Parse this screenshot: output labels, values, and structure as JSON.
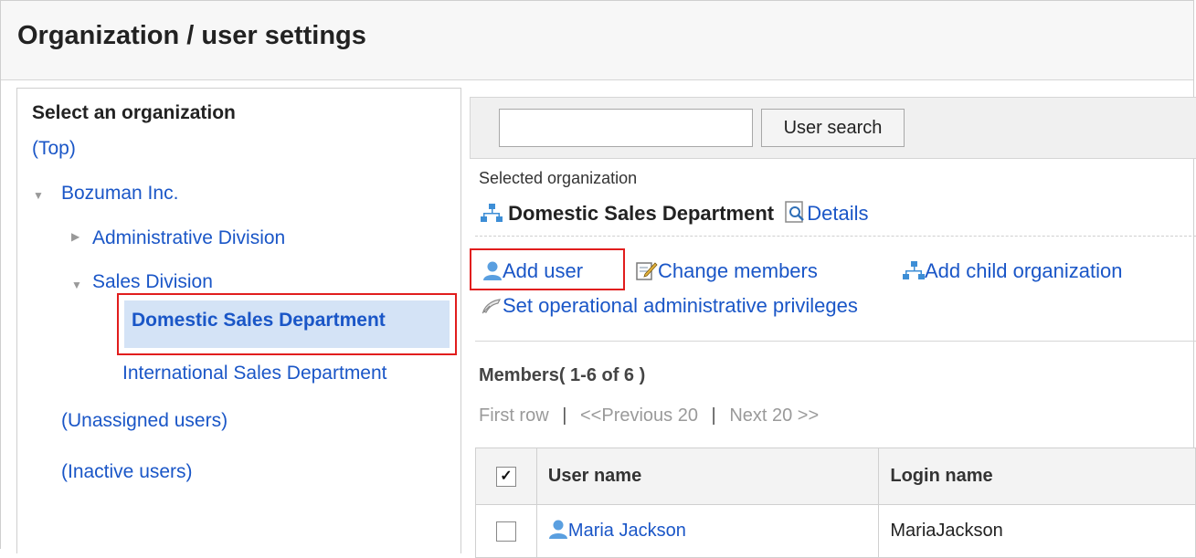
{
  "page": {
    "title": "Organization / user settings"
  },
  "left": {
    "heading": "Select an organization",
    "top_link": "(Top)",
    "tree": {
      "root": "Bozuman Inc.",
      "admin_division": "Administrative Division",
      "sales_division": "Sales Division",
      "domestic": "Domestic Sales Department",
      "international": "International Sales Department"
    },
    "unassigned": "(Unassigned users)",
    "inactive": "(Inactive users)"
  },
  "search": {
    "button_label": "User search",
    "value": "",
    "placeholder": ""
  },
  "selected": {
    "label": "Selected organization",
    "org_name": "Domestic Sales Department",
    "details_link": "Details"
  },
  "actions": {
    "add_user": "Add user",
    "change_members": "Change members",
    "add_child_org": "Add child organization",
    "set_privileges": "Set operational administrative privileges"
  },
  "members": {
    "title": "Members( 1-6 of 6 )",
    "pager": {
      "first": "First row",
      "prev": "<<Previous 20",
      "next": "Next 20 >>",
      "separator": "|"
    },
    "columns": {
      "check": "✓",
      "user_name": "User name",
      "login_name": "Login name"
    },
    "rows": [
      {
        "user_name": "Maria Jackson",
        "login_name": "MariaJackson"
      }
    ]
  },
  "colors": {
    "link": "#1a56c7",
    "highlight_border": "#e11d1d",
    "selected_bg": "#d4e3f6"
  },
  "icons": [
    "triangle-down-icon",
    "triangle-right-icon",
    "org-icon",
    "details-icon",
    "user-icon",
    "edit-icon",
    "privileges-icon"
  ]
}
